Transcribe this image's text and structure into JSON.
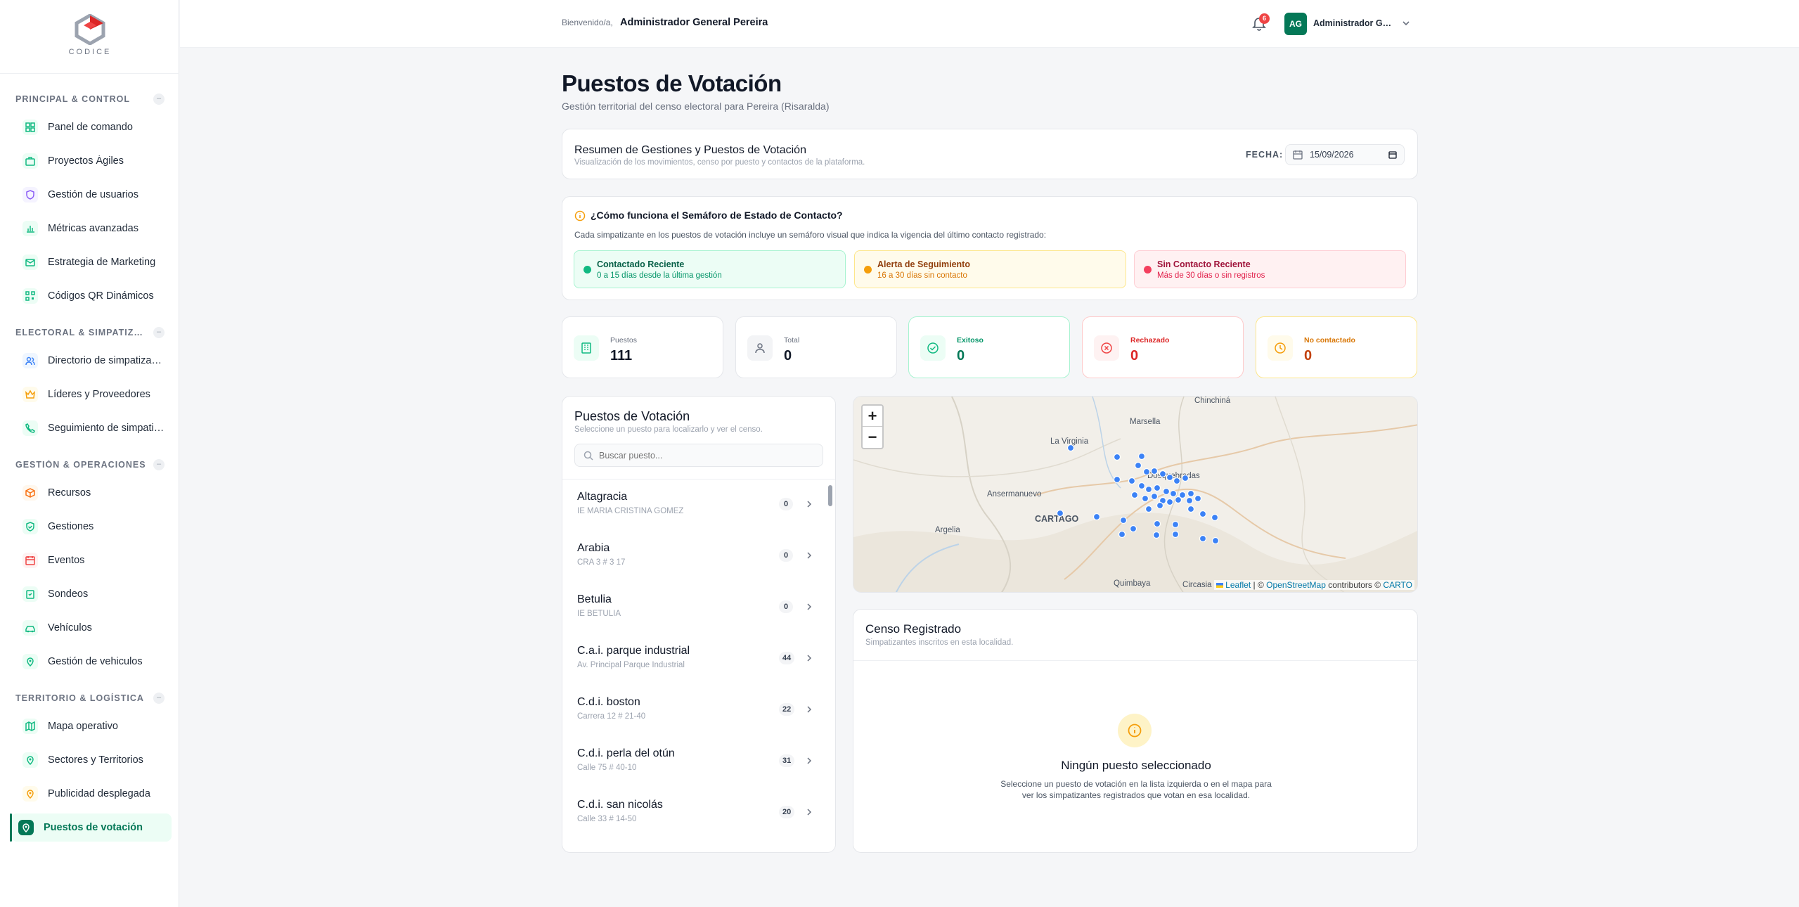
{
  "brand": {
    "name": "CODICE"
  },
  "sidebar": {
    "sections": [
      {
        "label": "PRINCIPAL & CONTROL",
        "items": [
          {
            "label": "Panel de comando",
            "icon": "dashboard-icon",
            "color": "#10b981"
          },
          {
            "label": "Proyectos Ágiles",
            "icon": "briefcase-icon",
            "color": "#10b981"
          },
          {
            "label": "Gestión de usuarios",
            "icon": "shield-icon",
            "color": "#8b5cf6"
          },
          {
            "label": "Métricas avanzadas",
            "icon": "bar-chart-icon",
            "color": "#10b981"
          },
          {
            "label": "Estrategia de Marketing",
            "icon": "mail-icon",
            "color": "#10b981"
          },
          {
            "label": "Códigos QR Dinámicos",
            "icon": "qr-icon",
            "color": "#10b981"
          }
        ]
      },
      {
        "label": "ELECTORAL & SIMPATIZANTES",
        "items": [
          {
            "label": "Directorio de simpatizantes",
            "icon": "users-icon",
            "color": "#3b82f6"
          },
          {
            "label": "Líderes y Proveedores",
            "icon": "crown-icon",
            "color": "#f59e0b"
          },
          {
            "label": "Seguimiento de simpatizantes",
            "icon": "phone-icon",
            "color": "#10b981"
          }
        ]
      },
      {
        "label": "GESTIÓN & OPERACIONES",
        "items": [
          {
            "label": "Recursos",
            "icon": "box-icon",
            "color": "#f97316"
          },
          {
            "label": "Gestiones",
            "icon": "shield-check-icon",
            "color": "#10b981"
          },
          {
            "label": "Eventos",
            "icon": "calendar-icon",
            "color": "#ef4444"
          },
          {
            "label": "Sondeos",
            "icon": "clipboard-icon",
            "color": "#10b981"
          },
          {
            "label": "Vehículos",
            "icon": "car-icon",
            "color": "#10b981"
          },
          {
            "label": "Gestión de vehiculos",
            "icon": "pin-icon",
            "color": "#10b981"
          }
        ]
      },
      {
        "label": "TERRITORIO & LOGÍSTICA",
        "items": [
          {
            "label": "Mapa operativo",
            "icon": "map-icon",
            "color": "#10b981"
          },
          {
            "label": "Sectores y Territorios",
            "icon": "pin-icon",
            "color": "#10b981"
          },
          {
            "label": "Publicidad desplegada",
            "icon": "pin-icon",
            "color": "#f59e0b"
          },
          {
            "label": "Puestos de votación",
            "icon": "pin-icon",
            "color": "#ffffff",
            "active": true
          }
        ]
      }
    ]
  },
  "header": {
    "welcome": "Bienvenido/a,",
    "user_full": "Administrador General Pereira",
    "notifications": "6",
    "avatar_initials": "AG",
    "user_short": "Administrador General Pereira"
  },
  "page": {
    "title": "Puestos de Votación",
    "subtitle": "Gestión territorial del censo electoral para Pereira (Risaralda)"
  },
  "summary": {
    "title": "Resumen de Gestiones y Puestos de Votación",
    "subtitle": "Visualización de los movimientos, censo por puesto y contactos de la plataforma.",
    "date_label": "FECHA:",
    "date_value": "15/09/2026"
  },
  "semaforo": {
    "title": "¿Cómo funciona el Semáforo de Estado de Contacto?",
    "description": "Cada simpatizante en los puestos de votación incluye un semáforo visual que indica la vigencia del último contacto registrado:",
    "items": [
      {
        "title": "Contactado Reciente",
        "subtitle": "0 a 15 días desde la última gestión",
        "color": "#10b981"
      },
      {
        "title": "Alerta de Seguimiento",
        "subtitle": "16 a 30 días sin contacto",
        "color": "#f59e0b"
      },
      {
        "title": "Sin Contacto Reciente",
        "subtitle": "Más de 30 días o sin registros",
        "color": "#f43f5e"
      }
    ]
  },
  "stats": [
    {
      "label": "Puestos",
      "value": "111",
      "icon": "building-icon"
    },
    {
      "label": "Total",
      "value": "0",
      "icon": "user-icon"
    },
    {
      "label": "Exitoso",
      "value": "0",
      "icon": "check-circle-icon"
    },
    {
      "label": "Rechazado",
      "value": "0",
      "icon": "x-circle-icon"
    },
    {
      "label": "No contactado",
      "value": "0",
      "icon": "clock-icon"
    }
  ],
  "list": {
    "title": "Puestos de Votación",
    "subtitle": "Seleccione un puesto para localizarlo y ver el censo.",
    "search_placeholder": "Buscar puesto...",
    "rows": [
      {
        "name": "Altagracia",
        "address": "IE MARIA CRISTINA GOMEZ",
        "count": "0"
      },
      {
        "name": "Arabia",
        "address": "CRA 3 # 3 17",
        "count": "0"
      },
      {
        "name": "Betulia",
        "address": "IE BETULIA",
        "count": "0"
      },
      {
        "name": "C.a.i. parque industrial",
        "address": "Av. Principal Parque Industrial",
        "count": "44"
      },
      {
        "name": "C.d.i. boston",
        "address": "Carrera 12 # 21-40",
        "count": "22"
      },
      {
        "name": "C.d.i. perla del otún",
        "address": "Calle 75 # 40-10",
        "count": "31"
      },
      {
        "name": "C.d.i. san nicolás",
        "address": "Calle 33 # 14-50",
        "count": "20"
      }
    ]
  },
  "map": {
    "zoom_in": "+",
    "zoom_out": "−",
    "labels": [
      "Chinchiná",
      "Marsella",
      "La Virginia",
      "Dosquebradas",
      "Ansermanuevo",
      "CARTAGO",
      "Argelia",
      "Quimbaya",
      "Circasia"
    ],
    "attribution_leaflet": "Leaflet",
    "attribution_sep": " | © ",
    "attribution_osm": "OpenStreetMap",
    "attribution_rest": " contributors © ",
    "attribution_carto": "CARTO"
  },
  "censo": {
    "title": "Censo Registrado",
    "subtitle": "Simpatizantes inscritos en esta localidad.",
    "empty_title": "Ningún puesto seleccionado",
    "empty_desc": "Seleccione un puesto de votación en la lista izquierda o en el mapa para ver los simpatizantes registrados que votan en esa localidad."
  }
}
